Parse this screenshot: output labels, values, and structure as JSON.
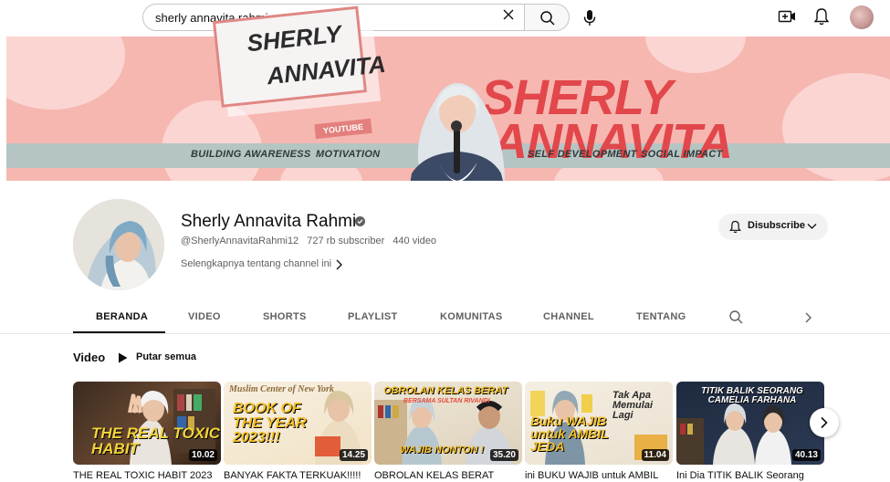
{
  "search": {
    "query": "sherly annavita rahmi"
  },
  "banner": {
    "logo_line1": "SHERLY",
    "logo_line2": "ANNAVITA",
    "logo_tag": "YOUTUBE",
    "name_line1": "SHERLY",
    "name_line2": "ANNAVITA",
    "topics": [
      "BUILDING AWARENESS",
      "MOTIVATION",
      "SELF DEVELOPMENT",
      "SOCIAL IMPACT"
    ],
    "colors": {
      "background": "#f6b7b1",
      "accent": "#e2474b",
      "strip": "#b5c5c3"
    }
  },
  "channel": {
    "name": "Sherly Annavita Rahmi",
    "handle": "@SherlyAnnavitaRahmi12",
    "subscribers": "727 rb subscriber",
    "videos": "440 video",
    "more_link": "Selengkapnya tentang channel ini",
    "subscribe_label": "Disubscribe"
  },
  "tabs": [
    {
      "label": "BERANDA",
      "active": true
    },
    {
      "label": "VIDEO",
      "active": false
    },
    {
      "label": "SHORTS",
      "active": false
    },
    {
      "label": "PLAYLIST",
      "active": false
    },
    {
      "label": "KOMUNITAS",
      "active": false
    },
    {
      "label": "CHANNEL",
      "active": false
    },
    {
      "label": "TENTANG",
      "active": false
    }
  ],
  "videos_section": {
    "title": "Video",
    "play_all": "Putar semua",
    "items": [
      {
        "title": "THE REAL TOXIC HABIT 2023",
        "duration": "10.02",
        "thumb_text": "THE REAL TOXIC HABIT"
      },
      {
        "title": "BANYAK FAKTA TERKUAK!!!!!",
        "duration": "14.25",
        "thumb_text": "BOOK OF THE YEAR 2023!!!",
        "thumb_sub": "Muslim Center of New York"
      },
      {
        "title": "OBROLAN KELAS BERAT",
        "duration": "35.20",
        "thumb_text": "OBROLAN KELAS BERAT",
        "thumb_sub": "BERSAMA SULTAN RIVANDI",
        "thumb_cta": "WAJIB NONTON !"
      },
      {
        "title": "ini BUKU WAJIB untuk AMBIL",
        "duration": "11.04",
        "thumb_text": "Buku WAJIB untuk AMBIL JEDA",
        "thumb_sub": "Tak Apa Memulai Lagi"
      },
      {
        "title": "Ini Dia TITIK BALIK Seorang",
        "duration": "40.13",
        "thumb_text": "TITIK BALIK SEORANG CAMELIA FARHANA"
      }
    ]
  }
}
